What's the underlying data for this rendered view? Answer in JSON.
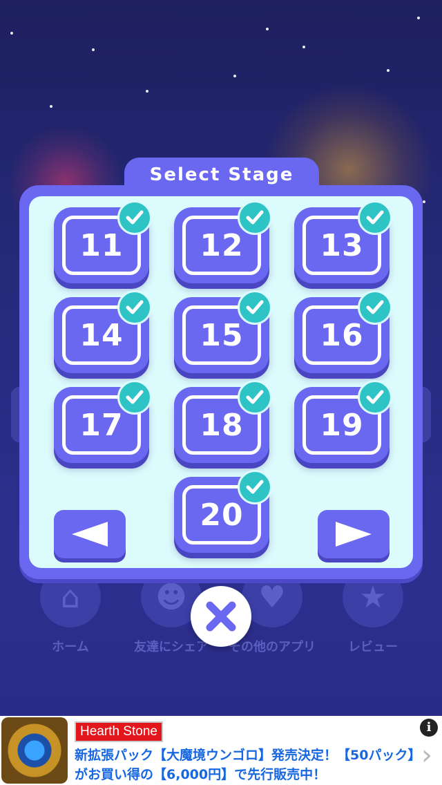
{
  "dialog": {
    "title": "Select Stage",
    "stages": [
      {
        "label": "11",
        "cleared": true
      },
      {
        "label": "12",
        "cleared": true
      },
      {
        "label": "13",
        "cleared": true
      },
      {
        "label": "14",
        "cleared": true
      },
      {
        "label": "15",
        "cleared": true
      },
      {
        "label": "16",
        "cleared": true
      },
      {
        "label": "17",
        "cleared": true
      },
      {
        "label": "18",
        "cleared": true
      },
      {
        "label": "19",
        "cleared": true
      },
      {
        "label": "20",
        "cleared": true
      }
    ]
  },
  "background_menu": {
    "items": [
      {
        "label": "ホーム",
        "icon": "home-icon"
      },
      {
        "label": "友達にシェア",
        "icon": "smiley-icon"
      },
      {
        "label": "その他のアプリ",
        "icon": "heart-icon"
      },
      {
        "label": "レビュー",
        "icon": "star-icon"
      }
    ]
  },
  "ad": {
    "badge": "Hearth Stone",
    "line1": "新拡張パック【大魔境ウンゴロ】発売決定！【50パック】",
    "line2": "がお買い得の【6,000円】で先行販売中！",
    "info": "i"
  },
  "colors": {
    "panel": "#6a67f0",
    "panel_inner": "#dcfbfd",
    "check": "#2ec3c4",
    "ad_text": "#1767e0",
    "ad_badge": "#e3161b"
  }
}
